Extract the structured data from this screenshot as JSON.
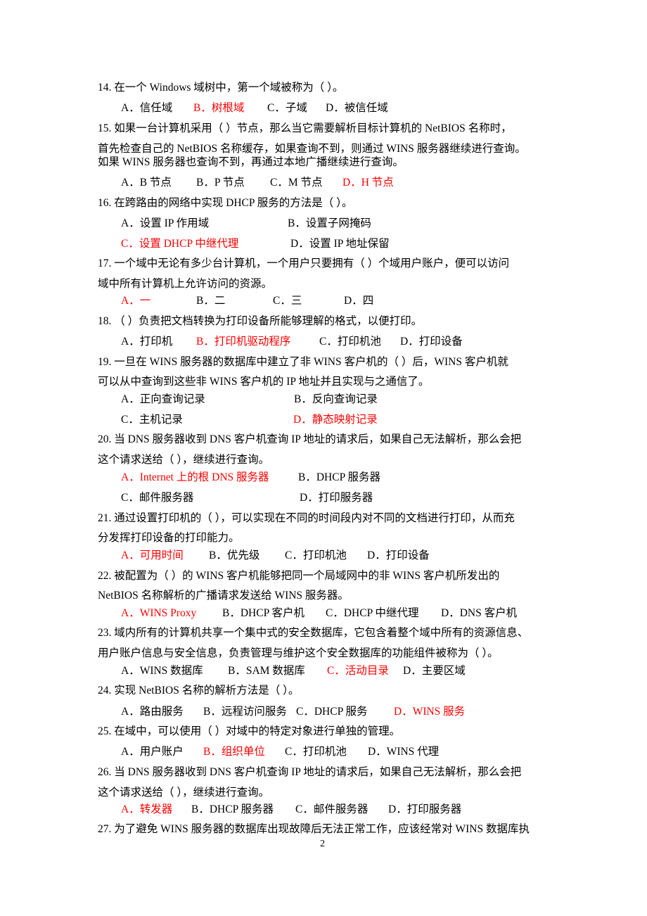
{
  "page_number": "2",
  "answer_color": "#ff0000",
  "questions": [
    {
      "lines": [
        "14.  在一个 Windows 域树中，第一个域被称为（      ）。"
      ],
      "options": [
        {
          "label": "A．信任域",
          "correct": false
        },
        {
          "label": "B．树根域",
          "correct": true
        },
        {
          "label": "C．子域",
          "correct": false
        },
        {
          "label": "D．被信任域",
          "correct": false
        }
      ]
    },
    {
      "lines": [
        "15.  如果一台计算机采用（      ）节点，那么当它需要解析目标计算机的 NetBIOS 名称时，",
        "首先检查自己的 NetBIOS  名称缓存，如果查询不到，则通过 WINS 服务器继续进行查询。",
        "如果 WINS 服务器也查询不到，再通过本地广播继续进行查询。"
      ],
      "options": [
        {
          "label": "A．B 节点",
          "correct": false
        },
        {
          "label": "B．P 节点",
          "correct": false
        },
        {
          "label": "C．M 节点",
          "correct": false
        },
        {
          "label": "D．H 节点",
          "correct": true
        }
      ]
    },
    {
      "lines": [
        "16.  在跨路由的网络中实现 DHCP 服务的方法是（        ）。"
      ],
      "options": [
        {
          "label": "A．设置 IP 作用域",
          "correct": false
        },
        {
          "label": "B．设置子网掩码",
          "correct": false
        },
        {
          "label": "C．设置 DHCP 中继代理",
          "correct": true
        },
        {
          "label": "D．设置 IP 地址保留",
          "correct": false
        }
      ]
    },
    {
      "lines": [
        "17.  一个域中无论有多少台计算机，一个用户只要拥有（      ）个域用户账户，便可以访问",
        "域中所有计算机上允许访问的资源。"
      ],
      "options": [
        {
          "label": "A．一",
          "correct": true
        },
        {
          "label": "B．二",
          "correct": false
        },
        {
          "label": "C．三",
          "correct": false
        },
        {
          "label": "D．四",
          "correct": false
        }
      ]
    },
    {
      "lines": [
        "18.  （      ）负责把文档转换为打印设备所能够理解的格式，以便打印。"
      ],
      "options": [
        {
          "label": "A．打印机",
          "correct": false
        },
        {
          "label": "B．打印机驱动程序",
          "correct": true
        },
        {
          "label": "C．打印机池",
          "correct": false
        },
        {
          "label": "D．打印设备",
          "correct": false
        }
      ]
    },
    {
      "lines": [
        "19.  一旦在 WINS 服务器的数据库中建立了非 WINS 客户机的（      ）后，WINS 客户机就",
        "可以从中查询到这些非 WINS 客户机的 IP 地址并且实现与之通信了。"
      ],
      "options": [
        {
          "label": "A．正向查询记录",
          "correct": false
        },
        {
          "label": "B．反向查询记录",
          "correct": false
        },
        {
          "label": "C．主机记录",
          "correct": false
        },
        {
          "label": "D．静态映射记录",
          "correct": true
        }
      ]
    },
    {
      "lines": [
        "20.  当 DNS 服务器收到 DNS 客户机查询 IP 地址的请求后，如果自己无法解析，那么会把",
        "这个请求送给（      ），继续进行查询。"
      ],
      "options": [
        {
          "label": "A．Internet 上的根 DNS 服务器",
          "correct": true
        },
        {
          "label": "B．DHCP 服务器",
          "correct": false
        },
        {
          "label": "C．邮件服务器",
          "correct": false
        },
        {
          "label": "D．打印服务器",
          "correct": false
        }
      ]
    },
    {
      "lines": [
        "21.  通过设置打印机的（      ），可以实现在不同的时间段内对不同的文档进行打印，从而充",
        "分发挥打印设备的打印能力。"
      ],
      "options": [
        {
          "label": "A．可用时间",
          "correct": true
        },
        {
          "label": "B．优先级",
          "correct": false
        },
        {
          "label": "C．打印机池",
          "correct": false
        },
        {
          "label": "D．打印设备",
          "correct": false
        }
      ]
    },
    {
      "lines": [
        "22.  被配置为（      ）的 WINS 客户机能够把同一个局域网中的非 WINS 客户机所发出的",
        "NetBIOS 名称解析的广播请求发送给 WINS 服务器。"
      ],
      "options": [
        {
          "label": "A．WINS Proxy",
          "correct": true
        },
        {
          "label": "B．DHCP 客户机",
          "correct": false
        },
        {
          "label": "C．DHCP 中继代理",
          "correct": false
        },
        {
          "label": "D．DNS 客户机",
          "correct": false
        }
      ]
    },
    {
      "lines": [
        "23.  域内所有的计算机共享一个集中式的安全数据库，它包含着整个域中所有的资源信息、",
        "用户账户信息与安全信息，负责管理与维护这个安全数据库的功能组件被称为（      ）。"
      ],
      "options": [
        {
          "label": "A．WINS 数据库",
          "correct": false
        },
        {
          "label": "B．SAM 数据库",
          "correct": false
        },
        {
          "label": "C．活动目录",
          "correct": true
        },
        {
          "label": "D．主要区域",
          "correct": false
        }
      ]
    },
    {
      "lines": [
        "24.  实现 NetBIOS 名称的解析方法是（      ）。"
      ],
      "options": [
        {
          "label": "A．路由服务",
          "correct": false
        },
        {
          "label": "B．远程访问服务",
          "correct": false
        },
        {
          "label": "C．DHCP 服务",
          "correct": false
        },
        {
          "label": "D．WINS 服务",
          "correct": true
        }
      ]
    },
    {
      "lines": [
        "25.  在域中，可以使用（      ）对域中的特定对象进行单独的管理。"
      ],
      "options": [
        {
          "label": "A．用户账户",
          "correct": false
        },
        {
          "label": "B．组织单位",
          "correct": true
        },
        {
          "label": "C．打印机池",
          "correct": false
        },
        {
          "label": "D．WINS 代理",
          "correct": false
        }
      ]
    },
    {
      "lines": [
        "26.  当 DNS 服务器收到 DNS 客户机查询 IP 地址的请求后，如果自己无法解析，那么会把",
        "这个请求送给（      ），继续进行查询。"
      ],
      "options": [
        {
          "label": "A．转发器",
          "correct": true
        },
        {
          "label": "B．DHCP 服务器",
          "correct": false
        },
        {
          "label": "C．邮件服务器",
          "correct": false
        },
        {
          "label": "D．打印服务器",
          "correct": false
        }
      ]
    },
    {
      "lines": [
        "27.  为了避免 WINS 服务器的数据库出现故障后无法正常工作，应该经常对 WINS 数据库执"
      ],
      "options": []
    }
  ]
}
